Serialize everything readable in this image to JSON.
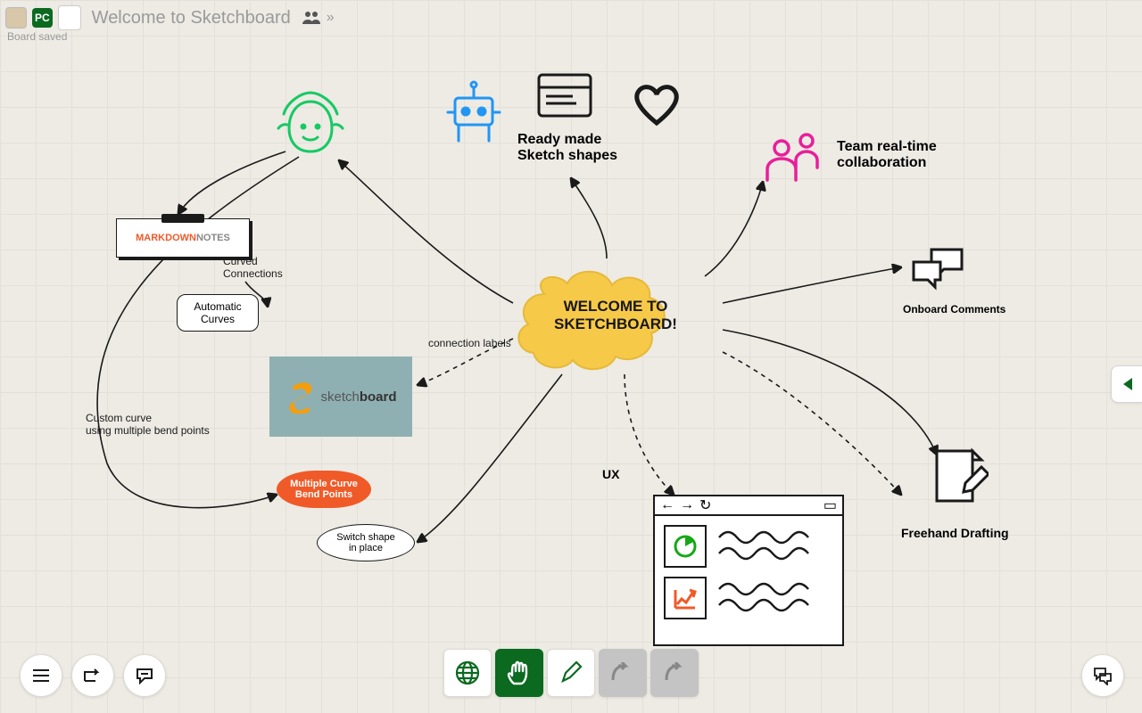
{
  "header": {
    "title": "Welcome to Sketchboard",
    "avatar_badge": "PC",
    "status": "Board saved"
  },
  "cloud": {
    "line1": "WELCOME TO",
    "line2": "SKETCHBOARD!"
  },
  "labels": {
    "ready_shapes_l1": "Ready made",
    "ready_shapes_l2": "Sketch shapes",
    "team_l1": "Team real-time",
    "team_l2": "collaboration",
    "onboard": "Onboard Comments",
    "freehand": "Freehand Drafting",
    "ux": "UX",
    "conn_labels": "connection labels",
    "curved_l1": "Curved",
    "curved_l2": "Connections",
    "custom_l1": "Custom curve",
    "custom_l2": "using multiple bend points",
    "markdown_a": "MARKDOWN",
    "markdown_b": " NOTES",
    "auto_l1": "Automatic",
    "auto_l2": "Curves",
    "pill_l1": "Multiple Curve",
    "pill_l2": "Bend Points",
    "ell_l1": "Switch shape",
    "ell_l2": "in place",
    "sb_brand_a": "sketch",
    "sb_brand_b": "board"
  }
}
